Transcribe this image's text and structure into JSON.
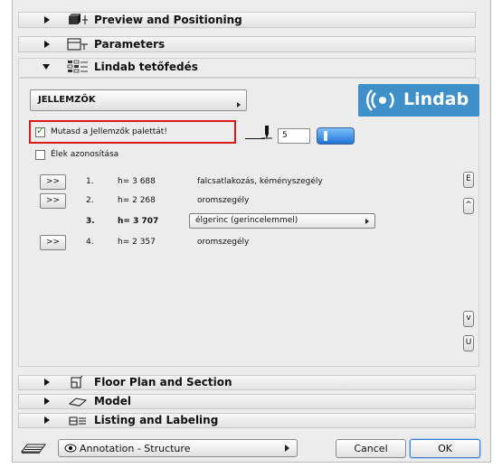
{
  "sections": {
    "preview": {
      "label": "Preview and Positioning",
      "icon": "cube-icon"
    },
    "parameters": {
      "label": "Parameters",
      "icon": "parameters-icon"
    },
    "lindab": {
      "label": "Lindab tetőfedés",
      "icon": "grid-icon"
    },
    "floor_plan": {
      "label": "Floor Plan and Section",
      "icon": "floor-plan-icon"
    },
    "model": {
      "label": "Model",
      "icon": "model-icon"
    },
    "listing": {
      "label": "Listing and Labeling",
      "icon": "listing-icon"
    }
  },
  "lindab_panel": {
    "properties_dropdown": "JELLEMZŐK",
    "logo_text": "Lindab",
    "show_palette_label": "Mutasd a Jellemzők palettát!",
    "show_palette_checked": true,
    "edge_id_label": "Élek azonosítása",
    "edge_id_checked": false,
    "pen_value": "5",
    "edges": [
      {
        "button": ">>",
        "num": "1.",
        "height": "h= 3 688",
        "type": "falcsatlakozás, kéményszegély",
        "selected": false
      },
      {
        "button": ">>",
        "num": "2.",
        "height": "h= 2 268",
        "type": "oromszegély",
        "selected": false
      },
      {
        "button": "",
        "num": "3.",
        "height": "h= 3 707",
        "type": "élgerinc (gerincelemmel)",
        "selected": true
      },
      {
        "button": ">>",
        "num": "4.",
        "height": "h= 2 357",
        "type": "oromszegély",
        "selected": false
      }
    ],
    "side_buttons": {
      "end_top": "E",
      "up": "^",
      "down": "v",
      "end_bottom": "U"
    }
  },
  "footer": {
    "view_select": "Annotation - Structure",
    "cancel_label": "Cancel",
    "ok_label": "OK"
  },
  "colors": {
    "highlight": "#e0171a",
    "logo_bg": "#3f8fc9",
    "toggle": "#2a7fe0"
  }
}
